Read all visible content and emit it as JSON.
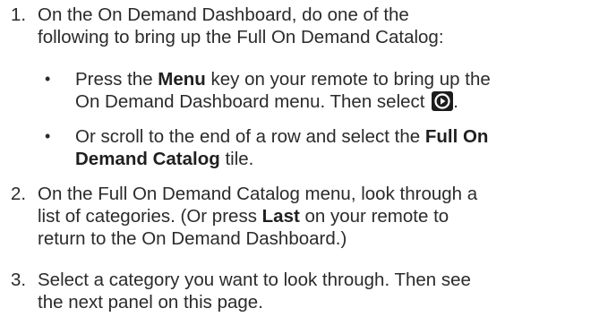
{
  "steps": [
    {
      "number": "1.",
      "line1": "On the On Demand Dashboard, do one of the",
      "line2": "following to bring up the Full On Demand Catalog:"
    },
    {
      "number": "2.",
      "line1": "On the Full On Demand Catalog menu, look through a",
      "line2": "list of categories. (Or press ",
      "line2_bold": "Last",
      "line2_end": " on your remote to",
      "line3": "return to the On Demand Dashboard.)"
    },
    {
      "number": "3.",
      "line1": "Select a category you want to look through. Then see",
      "line2": "the next panel on this page."
    }
  ],
  "bullets": [
    {
      "dot": "•",
      "l1_pre": "Press the ",
      "l1_bold": "Menu",
      "l1_post": " key on your remote to bring up the",
      "l2": "On Demand Dashboard menu. Then select ",
      "icon": "play-circle-icon",
      "l2_end": "."
    },
    {
      "dot": "•",
      "l1_pre": "Or scroll to the end of a row and select the ",
      "l1_bold": "Full On",
      "l2_bold": "Demand Catalog",
      "l2_post": " tile."
    }
  ]
}
